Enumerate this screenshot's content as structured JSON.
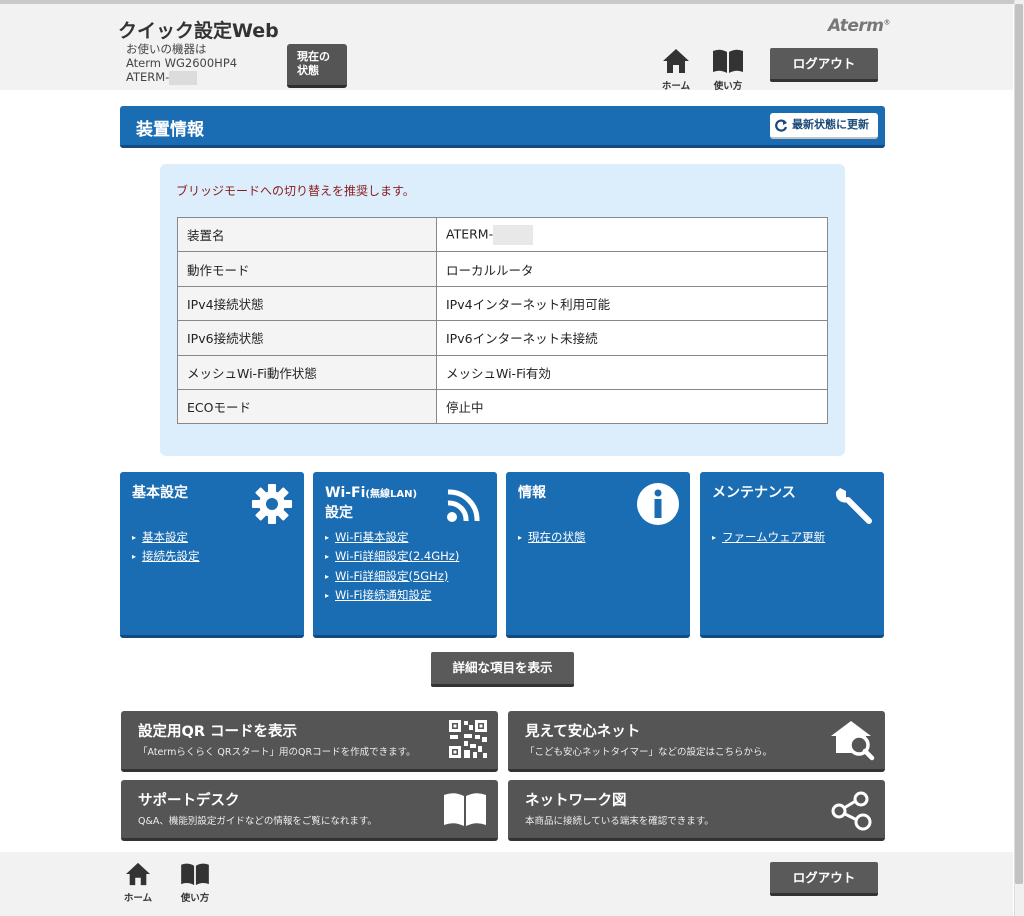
{
  "header": {
    "app_title": "クイック設定Web",
    "device_label": "お使いの機器は",
    "device_model": "Aterm WG2600HP4",
    "device_name": "ATERM-",
    "status_button": "現在の状態",
    "brand": "Aterm",
    "home_label": "ホーム",
    "manual_label": "使い方",
    "logout_label": "ログアウト"
  },
  "device_info": {
    "title": "装置情報",
    "refresh_label": "最新状態に更新",
    "notice": "ブリッジモードへの切り替えを推奨します。",
    "rows": [
      {
        "key": "装置名",
        "value": "ATERM-"
      },
      {
        "key": "動作モード",
        "value": "ローカルルータ"
      },
      {
        "key": "IPv4接続状態",
        "value": "IPv4インターネット利用可能"
      },
      {
        "key": "IPv6接続状態",
        "value": "IPv6インターネット未接続"
      },
      {
        "key": "メッシュWi-Fi動作状態",
        "value": "メッシュWi-Fi有効"
      },
      {
        "key": "ECOモード",
        "value": "停止中"
      }
    ]
  },
  "cards": [
    {
      "title": "基本設定",
      "icon": "gear-icon",
      "links": [
        "基本設定",
        "接続先設定"
      ]
    },
    {
      "title_main": "Wi-Fi",
      "title_small": "(無線LAN)",
      "title_line2": "設定",
      "icon": "wifi-icon",
      "links": [
        "Wi-Fi基本設定",
        "Wi-Fi詳細設定(2.4GHz)",
        "Wi-Fi詳細設定(5GHz)",
        "Wi-Fi接続通知設定"
      ]
    },
    {
      "title": "情報",
      "icon": "info-icon",
      "links": [
        "現在の状態"
      ]
    },
    {
      "title": "メンテナンス",
      "icon": "wrench-icon",
      "links": [
        "ファームウェア更新"
      ]
    }
  ],
  "detail_button": "詳細な項目を表示",
  "tiles": [
    {
      "title": "設定用QR コードを表示",
      "subtitle": "「Atermらくらく QRスタート」用のQRコードを作成できます。",
      "icon": "qr-code-icon"
    },
    {
      "title": "見えて安心ネット",
      "subtitle": "「こども安心ネットタイマー」などの設定はこちらから。",
      "icon": "house-search-icon"
    },
    {
      "title": "サポートデスク",
      "subtitle": "Q&A、機能別設定ガイドなどの情報をご覧になれます。",
      "icon": "book-icon"
    },
    {
      "title": "ネットワーク図",
      "subtitle": "本商品に接続している端末を確認できます。",
      "icon": "network-icon"
    }
  ],
  "footer": {
    "home_label": "ホーム",
    "manual_label": "使い方",
    "logout_label": "ログアウト"
  },
  "colors": {
    "primary_blue": "#1a6cb3",
    "panel_blue": "#dceefc",
    "dark_button": "#555555",
    "notice_red": "#8a1c1c"
  }
}
